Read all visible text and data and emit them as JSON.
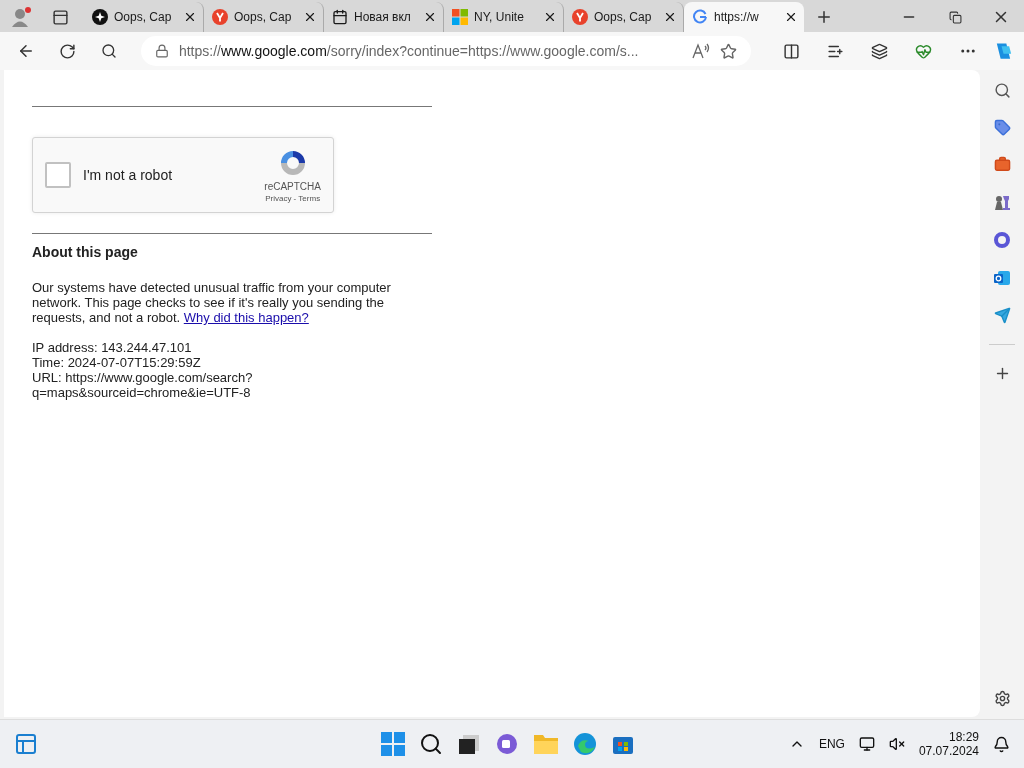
{
  "tabs": [
    {
      "kind": "circle",
      "title": "Oops, Cap",
      "selected": false
    },
    {
      "kind": "yandex",
      "title": "Oops, Cap",
      "selected": false
    },
    {
      "kind": "newtab",
      "title": "Новая вкл",
      "selected": false
    },
    {
      "kind": "microsoft",
      "title": "NY, Unite",
      "selected": false
    },
    {
      "kind": "yandex",
      "title": "Oops, Cap",
      "selected": false
    },
    {
      "kind": "google",
      "title": "https://w",
      "selected": true
    }
  ],
  "address_bar": {
    "scheme": "https://",
    "domain": "www.google.com",
    "path": "/sorry/index?continue=https://www.google.com/s..."
  },
  "captcha": {
    "label": "I'm not a robot",
    "checked": false,
    "brand": "reCAPTCHA",
    "links": "Privacy - Terms"
  },
  "about": {
    "heading": "About this page",
    "text": "Our systems have detected unusual traffic from your computer network. This page checks to see if it's really you sending the requests, and not a robot.",
    "link": "Why did this happen?",
    "details": [
      "IP address: 143.244.47.101",
      "Time: 2024-07-07T15:29:59Z",
      "URL: https://www.google.com/search?q=maps&sourceid=chrome&ie=UTF-8"
    ]
  },
  "taskbar": {
    "language": "ENG",
    "time": "18:29",
    "date": "07.07.2024"
  }
}
